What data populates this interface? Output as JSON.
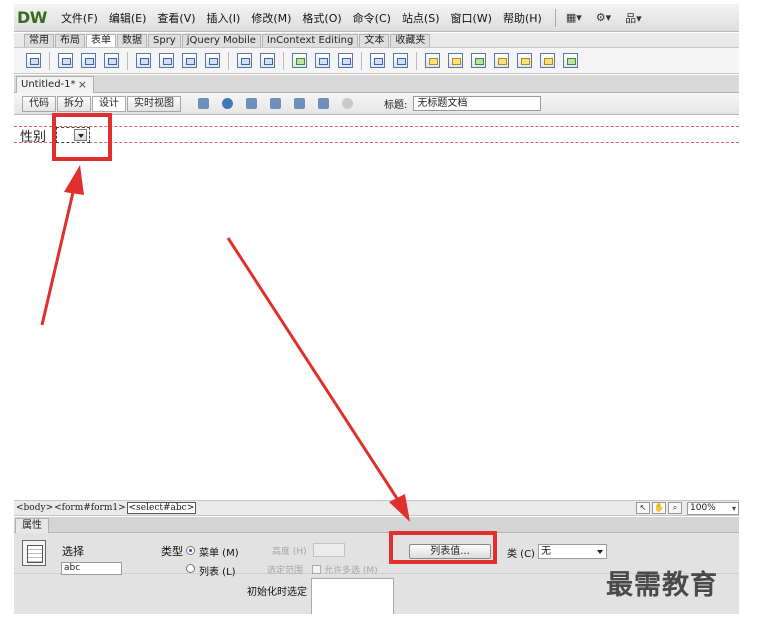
{
  "app": {
    "logo": "DW"
  },
  "menu": {
    "items": [
      "文件(F)",
      "编辑(E)",
      "查看(V)",
      "插入(I)",
      "修改(M)",
      "格式(O)",
      "命令(C)",
      "站点(S)",
      "窗口(W)",
      "帮助(H)"
    ],
    "right_icons": [
      "layout-icon",
      "gear-icon",
      "site-icon"
    ]
  },
  "insert_tabs": {
    "items": [
      "常用",
      "布局",
      "表单",
      "数据",
      "Spry",
      "jQuery Mobile",
      "InContext Editing",
      "文本",
      "收藏夹"
    ],
    "active_index": 2
  },
  "document": {
    "tab_label": "Untitled-1*",
    "close_glyph": "×"
  },
  "doc_toolbar": {
    "views": [
      "代码",
      "拆分",
      "设计",
      "实时视图"
    ],
    "active_view": "设计",
    "title_label": "标题:",
    "title_value": "无标题文档"
  },
  "canvas": {
    "field_label": "性别"
  },
  "status_bar": {
    "tags": [
      "<body>",
      "<form#form1>",
      "<select#abc>"
    ],
    "selected_tag": "<select#abc>",
    "zoom": "100%"
  },
  "properties": {
    "tab_label": "属性",
    "select_label": "选择",
    "select_name": "abc",
    "type_label": "类型",
    "type_menu": "菜单 (M)",
    "type_list": "列表 (L)",
    "height_label": "高度 (H)",
    "selection_label": "选定范围",
    "allow_multiple": "允许多选 (M)",
    "list_values_button": "列表值...",
    "class_label": "类 (C)",
    "class_value": "无",
    "initial_label": "初始化时选定"
  },
  "watermark": "最需教育",
  "colors": {
    "annotation_red": "#e0302e",
    "form_border": "#e06060",
    "logo_green": "#3b6b1e"
  }
}
